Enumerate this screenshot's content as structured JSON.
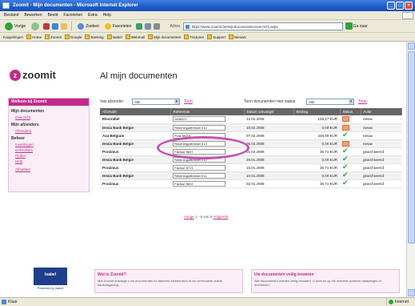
{
  "window": {
    "title": "Zoomit - Mijn documenten - Microsoft Internet Explorer",
    "controls": [
      "_",
      "□",
      "×"
    ]
  },
  "menu": [
    "Bestand",
    "Bewerken",
    "Beeld",
    "Favorieten",
    "Extra",
    "Help"
  ],
  "toolbar": {
    "back": "Vorige",
    "search": "Zoeken",
    "favorites": "Favorieten",
    "address_label": "Adres",
    "address": "https://www.zoomit.be/mijndocumenten/overzicht.aspx",
    "go": "Ga naar",
    "links_label": "Koppelingen"
  },
  "links": [
    "Home",
    "Zoomit",
    "Google",
    "Banking",
    "Isabel",
    "Webmail",
    "Mijn documenten",
    "Facturen",
    "Support",
    "Nieuws"
  ],
  "logo": {
    "mark": "z",
    "text": "zoomit"
  },
  "page": {
    "title": "Al mijn documenten"
  },
  "sidebar": {
    "header": "Welkom bij Zoomit",
    "sections": [
      {
        "label": "Mijn documenten",
        "links": [
          "Overzicht"
        ]
      },
      {
        "label": "Mijn afzenders",
        "links": [
          "Afzenders"
        ]
      },
      {
        "label": "Beheer",
        "links": [
          "Instellingen",
          "Gebruikers",
          "Profiel",
          "Help"
        ]
      }
    ],
    "extra_link": "Afmelden"
  },
  "filters": {
    "sender_label": "Van afzender",
    "sender_value": "Alle",
    "status_label": "Toon documenten met status",
    "status_value": "Alle",
    "go_label": "Toon"
  },
  "table": {
    "columns": [
      "Afzender",
      "Referentie",
      "Datum ontvangst",
      "Bedrag",
      "Status",
      "Actie"
    ],
    "rows": [
      {
        "sender": "Electrabel",
        "ref": "2458221",
        "date": "12.02.2008",
        "amount": "125,17 EUR",
        "status": "orange",
        "action": "nieuw",
        "alt": false
      },
      {
        "sender": "Dexia Bank Belgie",
        "ref": "Rekeninguittreksel 014",
        "date": "10.02.2008",
        "amount": "0,00 EUR",
        "status": "orange",
        "action": "nieuw",
        "alt": true
      },
      {
        "sender": "Axa Belgium",
        "ref": "Polis 59201",
        "date": "07.02.2008",
        "amount": "248,90 EUR",
        "status": "check",
        "action": "nieuw",
        "alt": false
      },
      {
        "sender": "Dexia Bank Belgie",
        "ref": "Rekeninguittreksel 013",
        "date": "05.02.2008",
        "amount": "0,00 EUR",
        "status": "orange",
        "action": "nieuw",
        "alt": true
      },
      {
        "sender": "Proximus",
        "ref": "Factuur 8847",
        "date": "01.02.2008",
        "amount": "36,71 EUR",
        "status": "check",
        "action": "gearchiveerd",
        "alt": false
      },
      {
        "sender": "Dexia Bank Belgie",
        "ref": "Rekeninguittreksel 012",
        "date": "28.01.2008",
        "amount": "0,00 EUR",
        "status": "check",
        "action": "gearchiveerd",
        "alt": true
      },
      {
        "sender": "Proximus",
        "ref": "Factuur 8721",
        "date": "15.01.2008",
        "amount": "36,71 EUR",
        "status": "check",
        "action": "gearchiveerd",
        "alt": false
      },
      {
        "sender": "Dexia Bank Belgie",
        "ref": "Rekeninguittreksel 011",
        "date": "10.01.2008",
        "amount": "0,00 EUR",
        "status": "check",
        "action": "gearchiveerd",
        "alt": true
      },
      {
        "sender": "Proximus",
        "ref": "Factuur 8602",
        "date": "02.01.2008",
        "amount": "36,71 EUR",
        "status": "check",
        "action": "gearchiveerd",
        "alt": false
      }
    ]
  },
  "pager": {
    "prev": "Vorige",
    "info": "1 - 9 van 9",
    "next": "Volgende"
  },
  "promo": {
    "title": "Isabel",
    "subtitle": "Powered by Isabel"
  },
  "info_left": {
    "title": "Wat is Zoomit?",
    "text": "Met Zoomit ontvangt u uw documenten en facturen elektronisch in uw vertrouwde online bankomgeving."
  },
  "info_right": {
    "title": "Uw documenten veilig bewaren",
    "text": "Alle documenten worden veilig bewaard. U kunt ze op elk moment opnieuw raadplegen of archiveren."
  },
  "status": {
    "text": "Klaar",
    "zone": "Internet"
  }
}
